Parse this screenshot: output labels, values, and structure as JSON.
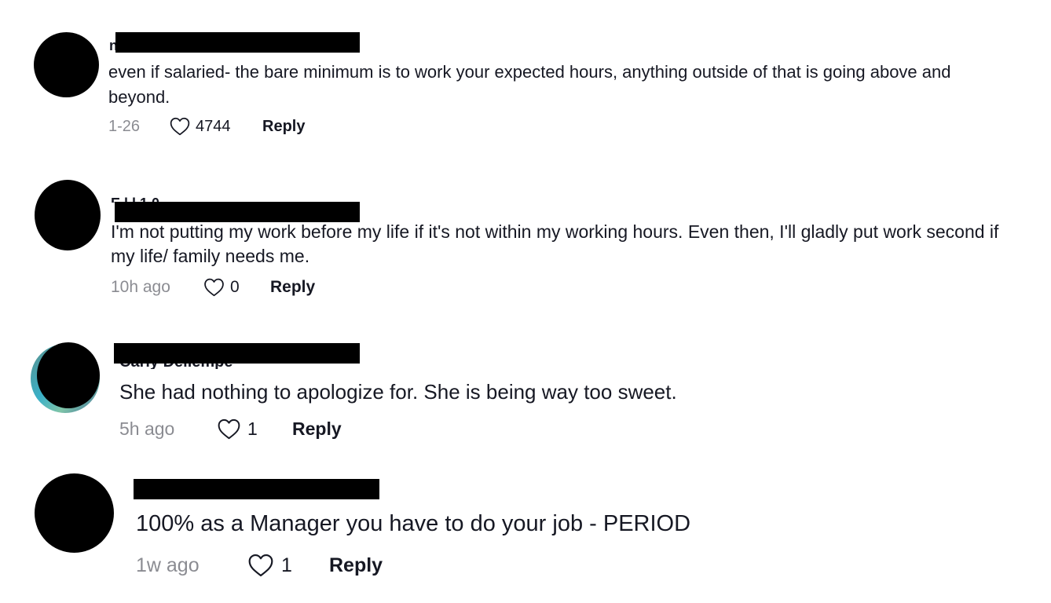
{
  "comments": [
    {
      "username_fragment": "n",
      "text": "even if salaried- the bare minimum is to work your expected hours, anything outside of that is going above and beyond.",
      "date": "1-26",
      "likes": "4744",
      "reply_label": "Reply"
    },
    {
      "username_fragment": "E  l l  1 0",
      "text": "I'm not putting my work before my life if it's not within my working hours. Even then, I'll gladly put work second if my life/ family needs me.",
      "date": "10h ago",
      "likes": "0",
      "reply_label": "Reply"
    },
    {
      "username_fragment": "Carly Dellempe",
      "text": "She had nothing to apologize for. She is being way too sweet.",
      "date": "5h ago",
      "likes": "1",
      "reply_label": "Reply"
    },
    {
      "username_fragment": "",
      "text": "100% as a Manager you have to do your job - PERIOD",
      "date": "1w ago",
      "likes": "1",
      "reply_label": "Reply"
    }
  ],
  "icons": {
    "like": "heart-outline-icon"
  },
  "colors": {
    "text": "#161823",
    "muted": "#8a8b91",
    "redaction": "#000000"
  }
}
